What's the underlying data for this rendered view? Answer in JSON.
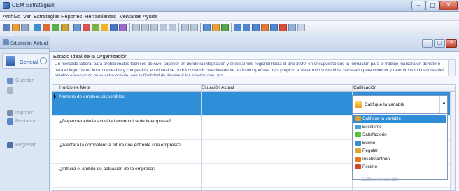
{
  "window": {
    "title": "CEM Estrategia®",
    "buttons": {
      "minimize": "–",
      "maximize": "▢",
      "close": "✕"
    }
  },
  "menu": {
    "items": [
      "Archivo",
      "Ver",
      "Estrategias",
      "Reportes",
      "Herramientas",
      "Ventanas",
      "Ayuda"
    ]
  },
  "left_panel": {
    "title": "Situación Actual",
    "general_label": "General",
    "general_badge": "⌃",
    "items": [
      {
        "label": "Guardar",
        "icon": "save-icon"
      },
      {
        "label": "Imprimir",
        "icon": "print-icon"
      },
      {
        "label": "Restaurar",
        "icon": "restore-icon"
      },
      {
        "label": "Regresar",
        "icon": "back-icon"
      }
    ]
  },
  "main": {
    "section_title": "Estado Ideal de la Organización",
    "description": "Un mercado laboral para profesionales técnicos de nivel superior en donde la integración y el desarrollo regional hacia el año 2020, en el supuesto que la formación para el trabajo marcará un derrotero para el logro de un futuro deseable y compartido, en el cual se podrá construir colectivamente un futuro que sea más propicio al desarrollo sostenible, necesario para conocer y revertir los indicadores del empleo observados en nuestro estado, con la finalidad de disminuir los efectos que una",
    "columns": [
      "Horizonte Meta",
      "Situación Actual",
      "Calificación"
    ],
    "rows": [
      "Numero de empleos disponibles",
      "¿Dependera de la actividad economica de la empresa?",
      "¿Afectara la competencia futura que enfrente una empresa?",
      "¿Influira el ambito de actuacion de la empresa?"
    ],
    "combo_value": "Califique la variable",
    "options": [
      "Califique la variable",
      "Excelente",
      "Satisfactorio",
      "Bueno",
      "Regular",
      "Insatisfactorio",
      "Pésimo"
    ],
    "ghost_text": "Califique la variable"
  },
  "colors": {
    "selection": "#2f8ed8",
    "description_text": "#2e4f86",
    "option_icons": [
      "#e7a21f",
      "#4aa3d8",
      "#5bbf3a",
      "#3b8fd0",
      "#e0a82a",
      "#e57a18",
      "#d8442a"
    ]
  }
}
